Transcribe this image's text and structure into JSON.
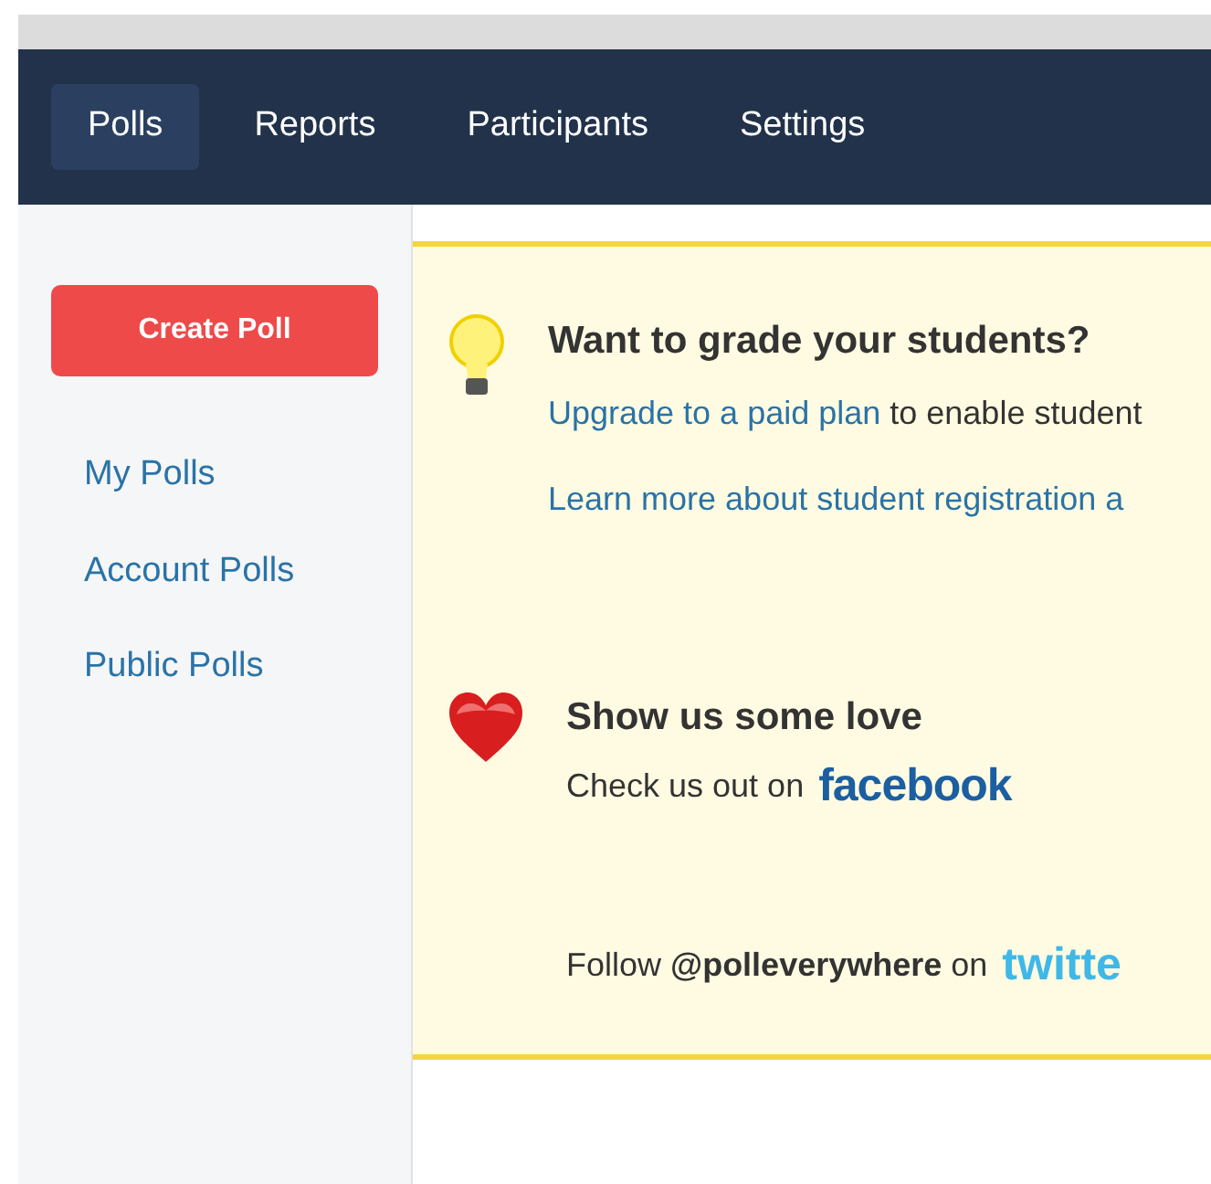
{
  "nav": {
    "tabs": [
      {
        "label": "Polls",
        "selected": true
      },
      {
        "label": "Reports",
        "selected": false
      },
      {
        "label": "Participants",
        "selected": false
      },
      {
        "label": "Settings",
        "selected": false
      }
    ]
  },
  "sidebar": {
    "create_button": "Create Poll",
    "items": [
      "My Polls",
      "Account Polls",
      "Public Polls"
    ]
  },
  "notice": {
    "grade": {
      "title": "Want to grade your students?",
      "upgrade": {
        "link": "Upgrade to a paid plan",
        "text": " to enable student"
      },
      "learn_more": "Learn more about student registration a"
    },
    "love": {
      "title": "Show us some love",
      "facebook_text": "Check us out on",
      "facebook_logo": "facebook",
      "twitter_text": "Follow **@polleverywhere** on",
      "twitter_logo": "twitte"
    }
  }
}
